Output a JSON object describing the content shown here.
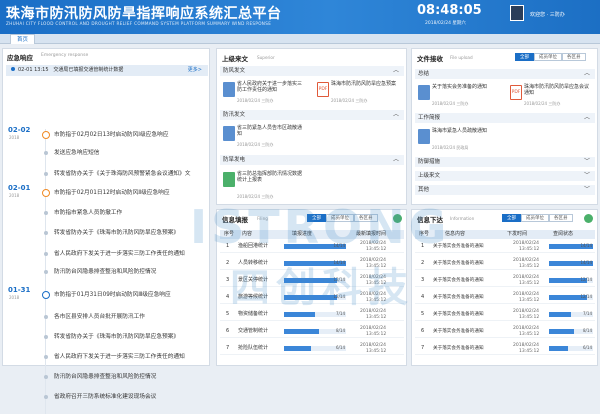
{
  "header": {
    "title": "珠海市防汛防风防旱指挥响应系统汇总平台",
    "subtitle": "ZHUHAI CITY FLOOD CONTROL AND DROUGHT RELIEF COMMAND SYSTEM PLATFORM SUMMARY WIND RESPONSE",
    "time": "08:48:05",
    "date": "2018/02/24 星期六",
    "welcome": "欢迎您 · 三防办"
  },
  "tabs": {
    "home": "首页"
  },
  "response": {
    "title": "应急响应",
    "subtitle": "Emergency response",
    "top_date": "02-01 13:15",
    "top_text": "交通局已填报交通管制统计数据",
    "more": "更多>",
    "items": [
      {
        "date": "02-02",
        "year": "2018",
        "text": "市防指于02月02日13时启动防风Ⅰ级应急响应",
        "marker": "major"
      },
      {
        "text": "发送应急响应短信",
        "marker": "minor"
      },
      {
        "text": "转发省防办关于《关于珠海防风预警紧急会议通知》文",
        "marker": "minor"
      },
      {
        "date": "02-01",
        "year": "2018",
        "text": "市防指于02月01日12时启动防风Ⅱ级应急响应",
        "marker": "major"
      },
      {
        "text": "市防指市紧急人员防撤工作",
        "marker": "minor"
      },
      {
        "text": "转发省防办关于《珠海市防汛防风防旱应急预案》",
        "marker": "minor"
      },
      {
        "text": "省人民政府下发关于进一步落实三防工作责任的通知",
        "marker": "minor"
      },
      {
        "text": "防汛防台风隐患排查整治和风险防控情况",
        "marker": "minor"
      },
      {
        "date": "01-31",
        "year": "2018",
        "text": "市防指于01月31日09时启动防风Ⅲ级应急响应",
        "marker": "blue"
      },
      {
        "text": "各市区县安排人员台批开展防汛工作",
        "marker": "minor"
      },
      {
        "text": "转发省防办关于《珠海市防汛防风防旱应急预案》",
        "marker": "minor"
      },
      {
        "text": "省人民政府下发关于进一步落实三防工作责任的通知",
        "marker": "minor"
      },
      {
        "text": "防汛防台风隐患排查整治和风险防控情况",
        "marker": "minor"
      },
      {
        "text": "省政府召开三防系统标准化建设现场会议",
        "marker": "minor"
      }
    ]
  },
  "superior": {
    "title": "上级来文",
    "subtitle": "Superior",
    "sections": {
      "s1": "防风发文",
      "s2": "防汛发文",
      "s3": "防旱发电"
    },
    "docs": [
      {
        "title": "省人民政府关于进一步落实三防工作责任的通知",
        "date": "2018/02/24 三防办",
        "icon": "doc-blue"
      },
      {
        "title": "珠海市防汛防风防旱应急预案",
        "date": "2018/02/24 三防办",
        "icon": "pdf"
      },
      {
        "title": "省三防紧急人员告市区疏散通知",
        "date": "2018/02/24 三防办",
        "icon": "doc-blue"
      },
      {
        "title": "省三防总指挥部防汛情况数据统计上报表",
        "date": "2018/02/24 三防办",
        "icon": "doc-green"
      }
    ]
  },
  "upload": {
    "title": "文件接收",
    "subtitle": "File upload",
    "seg": [
      "全部",
      "成员单位",
      "各区县"
    ],
    "sections": {
      "s1": "总结",
      "s2": "工作简报",
      "s3": "防御措施",
      "s4": "上级来文",
      "s5": "其他"
    },
    "docs": [
      {
        "title": "关于落实会务准备的通知",
        "date": "2018/02/24 三防办",
        "icon": "doc-blue"
      },
      {
        "title": "珠海市防汛防风防旱应急会议通知",
        "date": "2018/02/24 三防办",
        "icon": "pdf"
      },
      {
        "title": "珠海市紧急人员疏散通知",
        "date": "2018/02/24 民政局",
        "icon": "doc-blue"
      }
    ]
  },
  "filling": {
    "title": "信息填报",
    "subtitle": "Filing",
    "seg": [
      "全部",
      "成员单位",
      "各区县"
    ],
    "headers": {
      "no": "序号",
      "content": "内容",
      "progress": "填报进度",
      "time": "最新填报时间"
    },
    "rows": [
      {
        "no": "1",
        "content": "渔船回港统计",
        "progress": 1.0,
        "count": "14/14",
        "date": "2018/02/24",
        "time": "13:45:12"
      },
      {
        "no": "2",
        "content": "人员转移统计",
        "progress": 1.0,
        "count": "14/14",
        "date": "2018/02/24",
        "time": "13:45:12"
      },
      {
        "no": "3",
        "content": "景区关停统计",
        "progress": 0.86,
        "count": "12/14",
        "date": "2018/02/24",
        "time": "13:45:12"
      },
      {
        "no": "4",
        "content": "旅游等候统计",
        "progress": 0.86,
        "count": "12/14",
        "date": "2018/02/24",
        "time": "13:45:12"
      },
      {
        "no": "5",
        "content": "物资储备统计",
        "progress": 0.5,
        "count": "7/14",
        "date": "2018/02/24",
        "time": "13:45:12"
      },
      {
        "no": "6",
        "content": "交通管制统计",
        "progress": 0.57,
        "count": "8/14",
        "date": "2018/02/24",
        "time": "13:45:12"
      },
      {
        "no": "7",
        "content": "抢险队伍统计",
        "progress": 0.43,
        "count": "6/14",
        "date": "2018/02/24",
        "time": "13:45:12"
      }
    ]
  },
  "info": {
    "title": "信息下达",
    "subtitle": "Information",
    "seg": [
      "全部",
      "成员单位",
      "各区县"
    ],
    "headers": {
      "no": "序号",
      "content": "信息内容",
      "time": "下发时间",
      "status": "查阅状态"
    },
    "rows": [
      {
        "no": "1",
        "content": "关于落实会务准备的通知",
        "date": "2018/02/24",
        "time": "13:45:12",
        "progress": 1.0,
        "count": "14/14"
      },
      {
        "no": "2",
        "content": "关于落实会务准备的通知",
        "date": "2018/02/24",
        "time": "13:45:12",
        "progress": 1.0,
        "count": "14/14"
      },
      {
        "no": "3",
        "content": "关于落实会务准备的通知",
        "date": "2018/02/24",
        "time": "13:45:12",
        "progress": 0.86,
        "count": "12/14"
      },
      {
        "no": "4",
        "content": "关于落实会务准备的通知",
        "date": "2018/02/24",
        "time": "13:45:12",
        "progress": 0.86,
        "count": "12/14"
      },
      {
        "no": "5",
        "content": "关于落实会务准备的通知",
        "date": "2018/02/24",
        "time": "13:45:12",
        "progress": 0.5,
        "count": "7/14"
      },
      {
        "no": "6",
        "content": "关于落实会务准备的通知",
        "date": "2018/02/24",
        "time": "13:45:12",
        "progress": 0.57,
        "count": "8/14"
      },
      {
        "no": "7",
        "content": "关于落实会务准备的通知",
        "date": "2018/02/24",
        "time": "13:45:12",
        "progress": 0.43,
        "count": "6/14"
      }
    ]
  },
  "watermark": {
    "line1": "ISTRONG",
    "line2": "四创科技"
  },
  "colors": {
    "primary": "#1a6ec6",
    "accent": "#f08a24"
  }
}
